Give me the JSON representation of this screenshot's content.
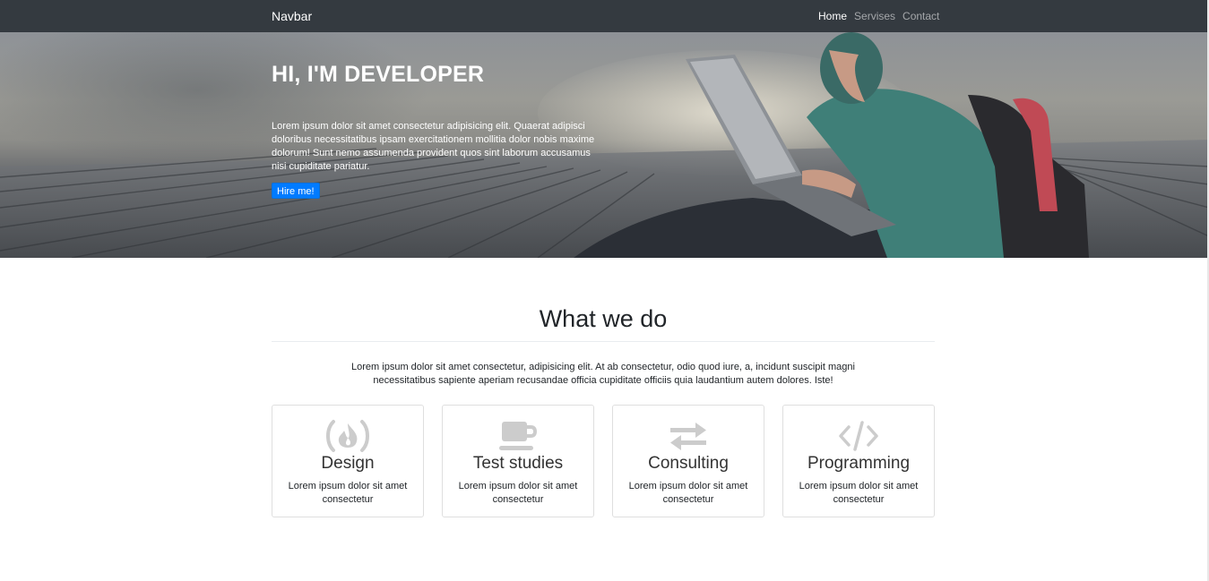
{
  "navbar": {
    "brand": "Navbar",
    "links": [
      {
        "label": "Home",
        "active": true
      },
      {
        "label": "Servises",
        "active": false
      },
      {
        "label": "Contact",
        "active": false
      }
    ]
  },
  "hero": {
    "title": "HI, I'M DEVELOPER",
    "text": "Lorem ipsum dolor sit amet consectetur adipisicing elit. Quaerat adipisci doloribus necessitatibus ipsam exercitationem mollitia dolor nobis maxime dolorum! Sunt nemo assumenda provident quos sint laborum accusamus nisi cupiditate pariatur.",
    "button": "Hire me!"
  },
  "section": {
    "title": "What we do",
    "text": "Lorem ipsum dolor sit amet consectetur, adipisicing elit. At ab consectetur, odio quod iure, a, incidunt suscipit magni necessitatibus sapiente aperiam recusandae officia cupiditate officiis quia laudantium autem dolores. Iste!"
  },
  "services": [
    {
      "icon": "free-code-camp-icon",
      "title": "Design",
      "text": "Lorem ipsum dolor sit amet consectetur"
    },
    {
      "icon": "coffee-icon",
      "title": "Test studies",
      "text": "Lorem ipsum dolor sit amet consectetur"
    },
    {
      "icon": "exchange-icon",
      "title": "Consulting",
      "text": "Lorem ipsum dolor sit amet consectetur"
    },
    {
      "icon": "code-icon",
      "title": "Programming",
      "text": "Lorem ipsum dolor sit amet consectetur"
    }
  ],
  "colors": {
    "navbar_bg": "#343a40",
    "button_bg": "#007bff",
    "icon_color": "#cccccc"
  }
}
